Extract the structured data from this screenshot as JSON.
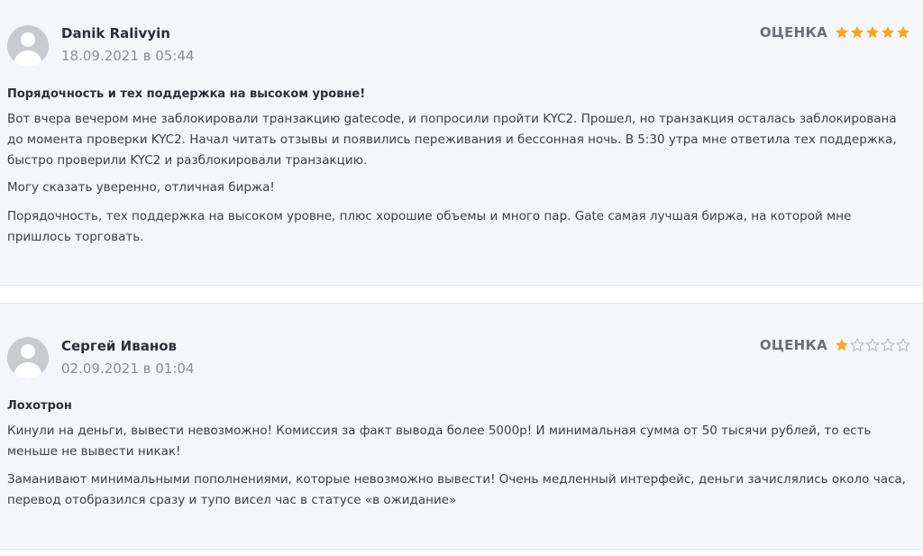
{
  "colors": {
    "star_filled": "#f5a623",
    "star_empty": "#b8bcc3",
    "card_background": "#f5f6f9"
  },
  "reviews": [
    {
      "author": "Danik Ralivyin",
      "date": "18.09.2021 в 05:44",
      "rating_label": "ОЦЕНКА",
      "rating": 5,
      "rating_max": 5,
      "title": "Порядочность и тех поддержка на высоком уровне!",
      "paragraphs": [
        "Вот вчера вечером мне заблокировали транзакцию gatecode, и попросили пройти KYC2. Прошел, но транзакция осталась заблокирована до момента проверки KYC2. Начал читать отзывы и появились переживания и бессонная ночь. В 5:30 утра мне ответила тех поддержка, быстро проверили KYC2 и разблокировали транзакцию.",
        "Могу сказать уверенно, отличная биржа!",
        "Порядочность, тех поддержка на высоком уровне, плюс хорошие объемы и много пар. Gate самая лучшая биржа, на которой мне пришлось торговать."
      ]
    },
    {
      "author": "Сергей Иванов",
      "date": "02.09.2021 в 01:04",
      "rating_label": "ОЦЕНКА",
      "rating": 1,
      "rating_max": 5,
      "title": "Лохотрон",
      "paragraphs": [
        "Кинули на деньги, вывести невозможно! Комиссия за факт вывода более 5000р! И минимальная сумма от 50 тысячи рублей, то есть меньше не вывести никак!",
        "Заманивают минимальными пополнениями, которые невозможно вывести! Очень медленный интерфейс, деньги зачислялись около часа, перевод отобразился сразу и тупо висел час в статусе «в ожидание»"
      ]
    }
  ]
}
